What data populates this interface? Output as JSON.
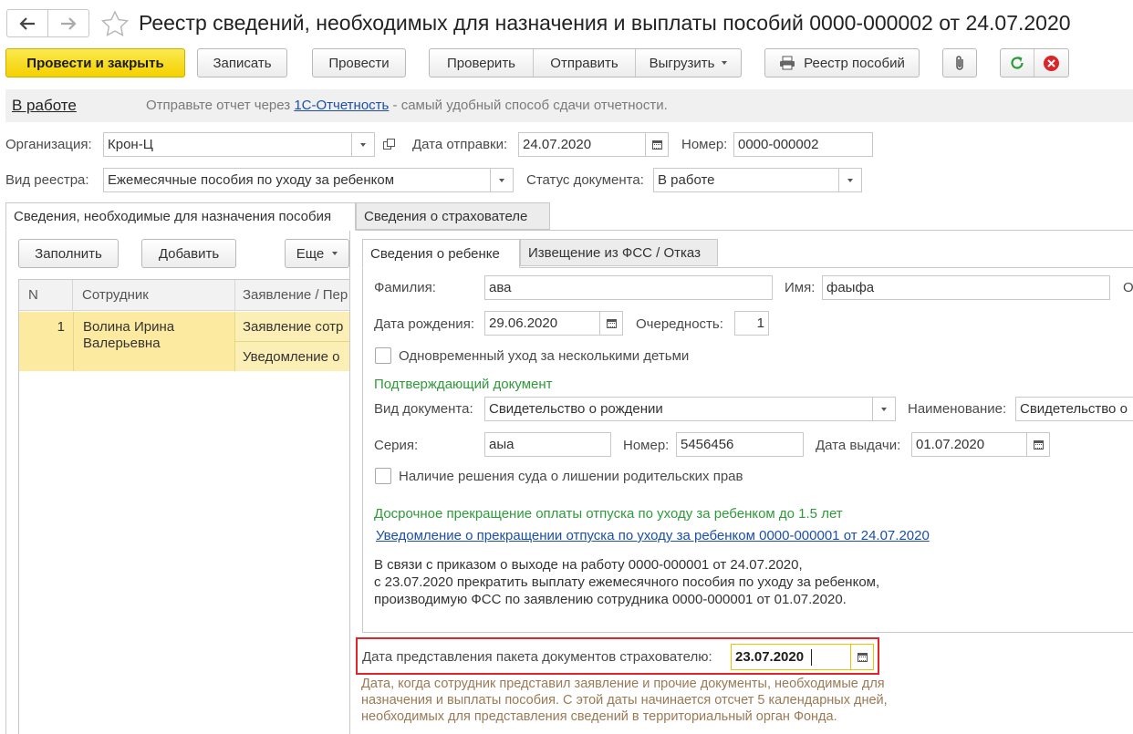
{
  "header": {
    "title": "Реестр сведений, необходимых для назначения и выплаты пособий 0000-000002 от 24.07.2020",
    "back_icon": "arrow-left-icon",
    "forward_icon": "arrow-right-icon",
    "favorite_icon": "star-icon"
  },
  "toolbar": {
    "post_close": "Провести и закрыть",
    "save": "Записать",
    "post": "Провести",
    "check": "Проверить",
    "send": "Отправить",
    "export": "Выгрузить",
    "registry": "Реестр пособий"
  },
  "status": {
    "label": "В работе",
    "prefix": "Отправьте отчет через ",
    "link": "1С-Отчетность",
    "suffix": " - самый удобный способ сдачи отчетности."
  },
  "form": {
    "org_label": "Организация:",
    "org_value": "Крон-Ц",
    "send_date_label": "Дата отправки:",
    "send_date_value": "24.07.2020",
    "number_label": "Номер:",
    "number_value": "0000-000002",
    "registry_type_label": "Вид реестра:",
    "registry_type_value": "Ежемесячные пособия по уходу за ребенком",
    "doc_status_label": "Статус документа:",
    "doc_status_value": "В работе"
  },
  "tabs": {
    "main": "Сведения, необходимые для назначения пособия",
    "insurer": "Сведения о страхователе"
  },
  "list": {
    "fill": "Заполнить",
    "add": "Добавить",
    "more": "Еще",
    "col_n": "N",
    "col_employee": "Сотрудник",
    "col_request": "Заявление / Пер",
    "rows": [
      {
        "n": "1",
        "employee": "Волина Ирина Валерьевна",
        "doc1": "Заявление сотр",
        "doc2": "Уведомление о"
      }
    ]
  },
  "subtabs": {
    "child": "Сведения о ребенке",
    "fss": "Извещение из ФСС / Отказ"
  },
  "child": {
    "surname_label": "Фамилия:",
    "surname_value": "ава",
    "name_label": "Имя:",
    "name_value": "фаыфа",
    "trailing": "О",
    "birth_label": "Дата рождения:",
    "birth_value": "29.06.2020",
    "order_label": "Очередность:",
    "order_value": "1",
    "multiple_care": "Одновременный уход за несколькими детьми",
    "confirm_heading": "Подтверждающий документ",
    "doc_type_label": "Вид документа:",
    "doc_type_value": "Свидетельство о рождении",
    "doc_name_label": "Наименование:",
    "doc_name_value": "Свидетельство о",
    "series_label": "Серия:",
    "series_value": "аыа",
    "doc_number_label": "Номер:",
    "doc_number_value": "5456456",
    "issue_date_label": "Дата выдачи:",
    "issue_date_value": "01.07.2020",
    "court_decision": "Наличие решения суда о лишении родительских прав",
    "early_heading": "Досрочное прекращение оплаты отпуска по уходу за ребенком до 1.5 лет",
    "notice_link": "Уведомление о прекращении отпуска по уходу за ребенком 0000-000001 от 24.07.2020",
    "notice_text": [
      "В связи с приказом о выходе на работу 0000-000001 от 24.07.2020,",
      "с 23.07.2020 прекратить выплату ежемесячного пособия по уходу за ребенком,",
      "производимую ФСС по заявлению сотрудника 0000-000001 от 01.07.2020."
    ]
  },
  "package": {
    "label": "Дата представления пакета документов страхователю:",
    "value": "23.07.2020",
    "hint": [
      "Дата, когда сотрудник представил заявление и прочие документы, необходимые для",
      "назначения и выплаты пособия. С этой даты начинается отсчет 5 календарных дней,",
      "необходимых для представления сведений в территориальный орган Фонда."
    ]
  },
  "colors": {
    "primary_button": "#f4d100",
    "selected_row": "#fbeaa0",
    "heading_green": "#2f9a3a",
    "link_blue": "#1d4fa3",
    "highlight_border": "#e0262a",
    "hint_brown": "#9a7a55"
  }
}
